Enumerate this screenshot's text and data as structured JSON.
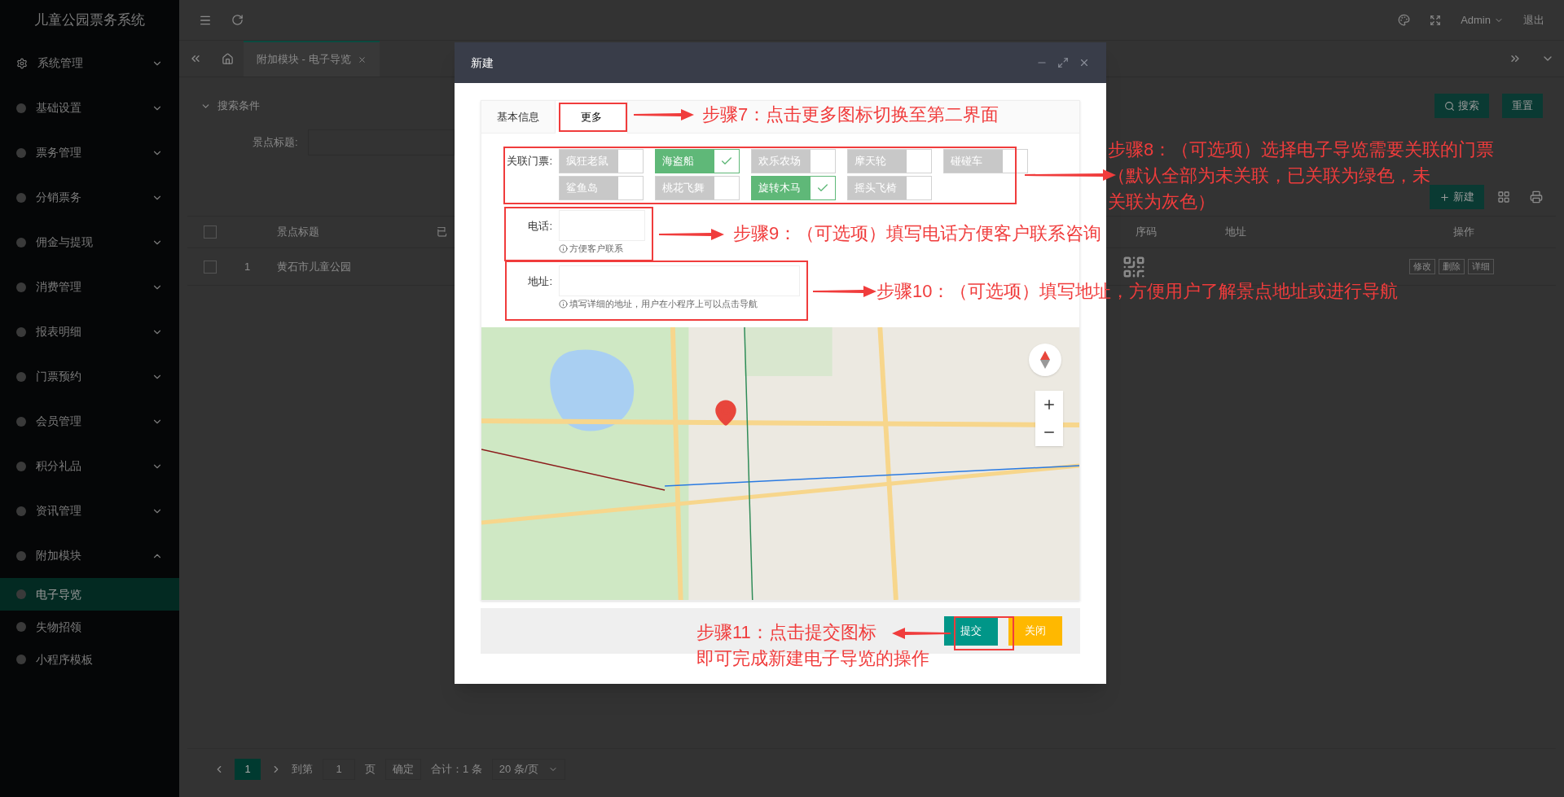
{
  "sidebar": {
    "title": "儿童公园票务系统",
    "items": [
      {
        "label": "系统管理",
        "expanded": false
      },
      {
        "label": "基础设置",
        "expanded": false
      },
      {
        "label": "票务管理",
        "expanded": false
      },
      {
        "label": "分销票务",
        "expanded": false
      },
      {
        "label": "佣金与提现",
        "expanded": false
      },
      {
        "label": "消费管理",
        "expanded": false
      },
      {
        "label": "报表明细",
        "expanded": false
      },
      {
        "label": "门票预约",
        "expanded": false
      },
      {
        "label": "会员管理",
        "expanded": false
      },
      {
        "label": "积分礼品",
        "expanded": false
      },
      {
        "label": "资讯管理",
        "expanded": false
      },
      {
        "label": "附加模块",
        "expanded": true,
        "children": [
          {
            "label": "电子导览",
            "selected": true
          },
          {
            "label": "失物招领",
            "selected": false
          },
          {
            "label": "小程序模板",
            "selected": false
          }
        ]
      }
    ]
  },
  "header": {
    "user": "Admin",
    "logout": "退出"
  },
  "page_tabs": [
    {
      "label": "附加模块 - 电子导览",
      "selected": true
    }
  ],
  "search": {
    "title": "搜索条件",
    "field_label": "景点标题:",
    "search_button": "搜索",
    "reset_button": "重置"
  },
  "toolbar": {
    "new_button": "新建"
  },
  "table": {
    "select_all": {
      "checked": false
    },
    "columns": [
      "景点标题",
      "已",
      "序码",
      "地址",
      "操作"
    ],
    "rows": [
      {
        "checked": false,
        "index": "1",
        "title": "黄石市儿童公园",
        "actions": [
          "修改",
          "删除",
          "详细"
        ]
      }
    ]
  },
  "pagination": {
    "pages": [
      {
        "label": "1",
        "selected": true
      }
    ],
    "goto_label": "到第",
    "goto_value": "1",
    "page_unit": "页",
    "confirm": "确定",
    "total": "合计：1 条",
    "page_size": "20 条/页"
  },
  "dialog": {
    "title": "新建",
    "tabs": [
      {
        "label": "基本信息",
        "selected": false
      },
      {
        "label": "更多",
        "selected": true
      }
    ],
    "tickets_label": "关联门票:",
    "tickets": [
      {
        "label": "疯狂老鼠",
        "selected": false
      },
      {
        "label": "海盗船",
        "selected": true
      },
      {
        "label": "欢乐农场",
        "selected": false
      },
      {
        "label": "摩天轮",
        "selected": false
      },
      {
        "label": "碰碰车",
        "selected": false
      },
      {
        "label": "鲨鱼岛",
        "selected": false
      },
      {
        "label": "桃花飞舞",
        "selected": false
      },
      {
        "label": "旋转木马",
        "selected": true
      },
      {
        "label": "摇头飞椅",
        "selected": false
      }
    ],
    "phone": {
      "label": "电话:",
      "hint": "方便客户联系"
    },
    "address": {
      "label": "地址:",
      "hint": "填写详细的地址，用户在小程序上可以点击导航"
    },
    "buttons": [
      {
        "label": "提交",
        "kind": "primary"
      },
      {
        "label": "关闭",
        "kind": "warning"
      }
    ]
  },
  "annotations": [
    {
      "lines": [
        "步骤7：点击更多图标切换至第二界面"
      ]
    },
    {
      "lines": [
        "步骤8：（可选项）选择电子导览需要关联的门票",
        "（默认全部为未关联，已关联为绿色，未",
        "关联为灰色）"
      ]
    },
    {
      "lines": [
        "步骤9：（可选项）填写电话方便客户联系咨询"
      ]
    },
    {
      "lines": [
        "步骤10：（可选项）填写地址，方便用户了解景点地址或进行导航"
      ]
    },
    {
      "lines": [
        "步骤11：点击提交图标",
        "即可完成新建电子导览的操作"
      ]
    }
  ]
}
